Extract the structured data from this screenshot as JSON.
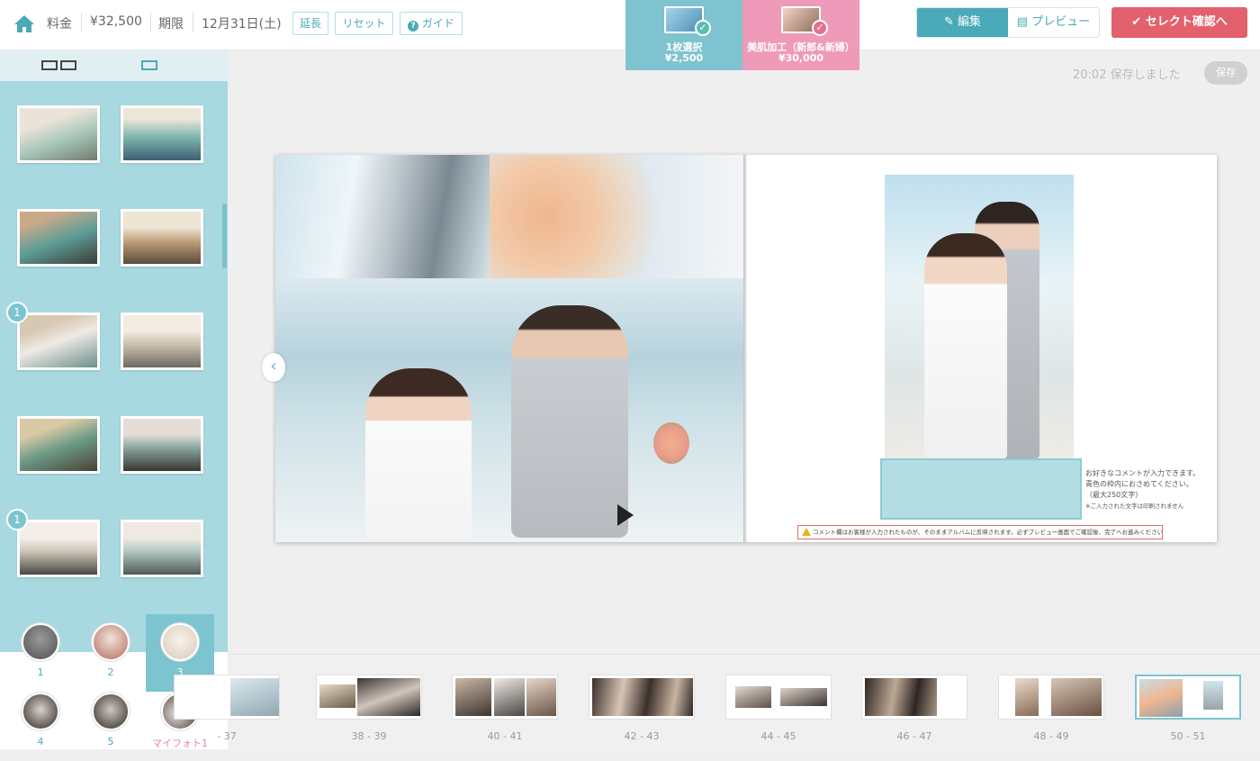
{
  "header": {
    "price_label": "料金",
    "price_value": "¥32,500",
    "deadline_label": "期限",
    "deadline_value": "12月31日(土)",
    "extend_label": "延長",
    "reset_label": "リセット",
    "guide_label": "ガイド"
  },
  "selection_tabs": [
    {
      "line1": "1枚選択",
      "line2": "¥2,500",
      "color": "#7ec3cf"
    },
    {
      "line1": "美肌加工（新郎&新婦）",
      "line2": "¥30,000",
      "color": "#ef9ab8"
    }
  ],
  "modes": {
    "edit_label": "編集",
    "preview_label": "プレビュー"
  },
  "confirm_label": "セレクト確認へ",
  "save": {
    "status": "20:02 保存しました",
    "button_label": "保存"
  },
  "sidebar": {
    "photo_badges": [
      "1",
      "1"
    ],
    "faces": [
      {
        "label": "1"
      },
      {
        "label": "2"
      },
      {
        "label": "3"
      },
      {
        "label": "4"
      },
      {
        "label": "5"
      },
      {
        "label": "マイフォト1"
      }
    ]
  },
  "editor": {
    "comment_hint": [
      "お好きなコメントが入力できます。",
      "青色の枠内におさめてください。",
      "（最大250文字）",
      "※ご入力された文字は印刷されません"
    ],
    "warning": "コメント欄はお客様が入力されたものが、そのままアルバムに反映されます。必ずプレビュー画面でご確認後、完了へお進みください。"
  },
  "filmstrip": {
    "pages": [
      "- 37",
      "38 - 39",
      "40 - 41",
      "42 - 43",
      "44 - 45",
      "46 - 47",
      "48 - 49",
      "50 - 51"
    ]
  },
  "colors": {
    "accent": "#4aaab8",
    "sidebar_bg": "#a8d9e0",
    "confirm": "#e2616c",
    "pink": "#ef9ab8"
  }
}
